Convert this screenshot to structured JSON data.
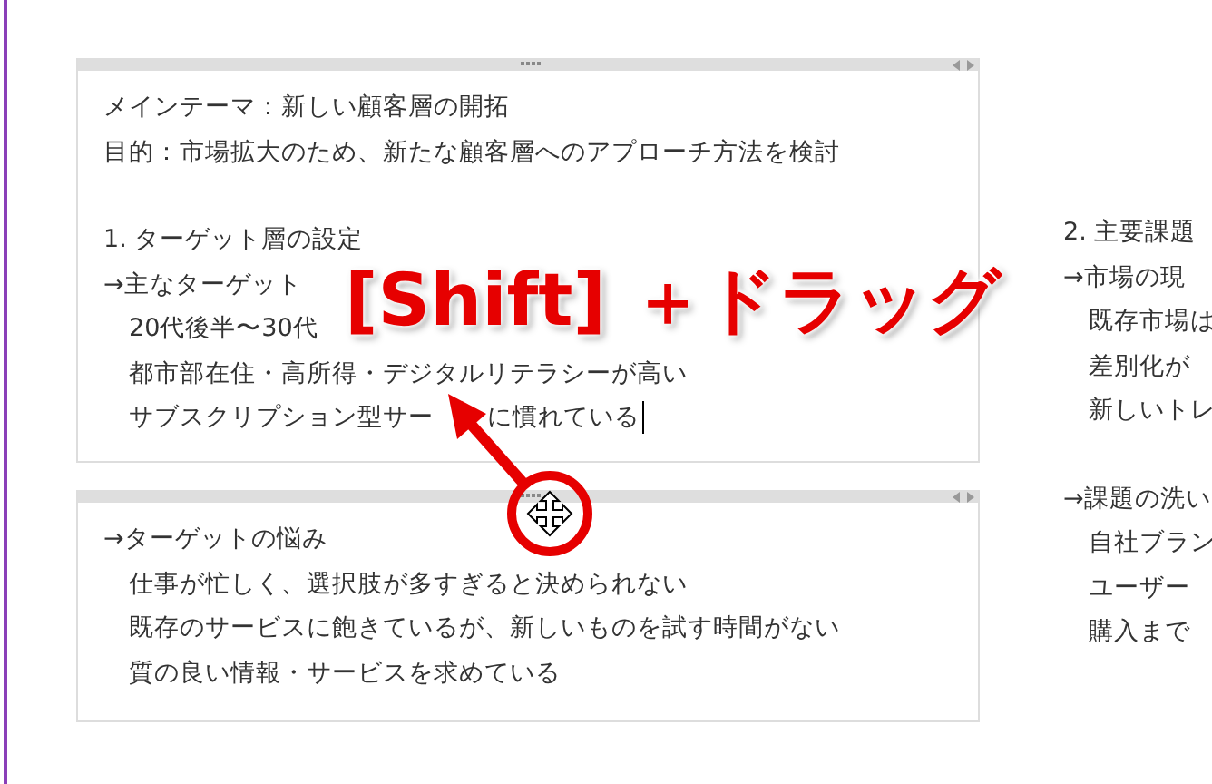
{
  "notes": [
    {
      "blocks": [
        {
          "lines": [
            {
              "parts": [
                "メインテーマ：新しい顧客層の開拓"
              ]
            },
            {
              "parts": [
                "目的：市場拡大のため、新たな顧客層へのアプローチ方法を検討"
              ]
            }
          ]
        },
        {
          "lines": [
            {
              "parts": [
                "1. ターゲット層の設定"
              ]
            },
            {
              "parts": [
                "→主なターゲット"
              ],
              "children": [
                {
                  "parts": [
                    "20代後半〜30代"
                  ]
                },
                {
                  "parts": [
                    "都市部在住・高所得・デジタルリテラシーが高い"
                  ]
                },
                {
                  "parts": [
                    "サブスクリプション型サー",
                    "に慣れている"
                  ],
                  "caret": true
                }
              ]
            }
          ]
        }
      ]
    },
    {
      "blocks": [
        {
          "lines": [
            {
              "parts": [
                "→ターゲットの悩み"
              ],
              "children": [
                {
                  "parts": [
                    "仕事が忙しく、選択肢が多すぎると決められない"
                  ]
                },
                {
                  "parts": [
                    "既存のサービスに飽きているが、新しいものを試す時間がない"
                  ]
                },
                {
                  "parts": [
                    "質の良い情報・サービスを求めている"
                  ]
                }
              ]
            }
          ]
        }
      ]
    }
  ],
  "side_column": {
    "blocks": [
      {
        "lines": [
          {
            "parts": [
              "2. 主要課題"
            ]
          },
          {
            "parts": [
              "→市場の現"
            ],
            "children": [
              {
                "parts": [
                  "既存市場は"
                ]
              },
              {
                "parts": [
                  "差別化が"
                ]
              },
              {
                "parts": [
                  "新しいトレ"
                ]
              }
            ]
          }
        ]
      },
      {
        "lines": [
          {
            "parts": [
              "→課題の洗い"
            ],
            "children": [
              {
                "parts": [
                  "自社ブラン"
                ]
              },
              {
                "parts": [
                  "ユーザー"
                ]
              },
              {
                "parts": [
                  "購入まで"
                ]
              }
            ]
          }
        ]
      }
    ]
  },
  "annotation": {
    "label": "[Shift] ＋ドラッグ"
  }
}
